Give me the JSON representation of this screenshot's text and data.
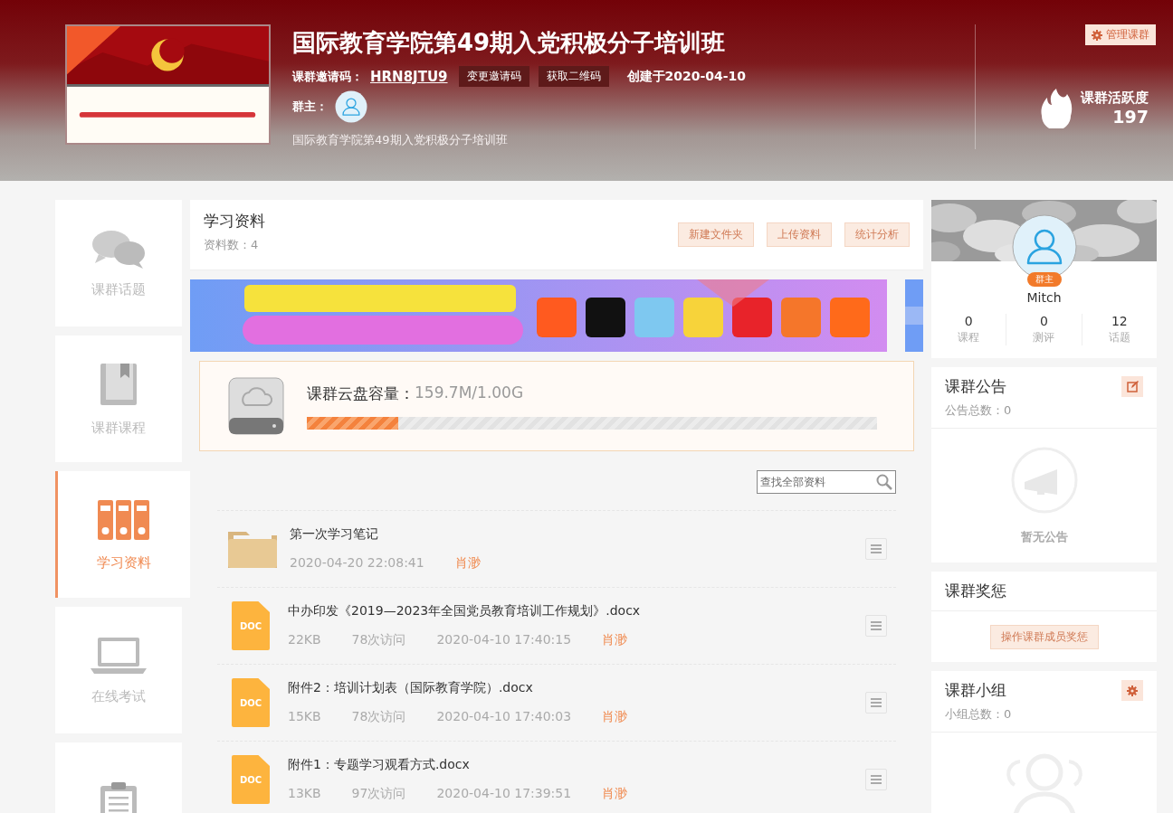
{
  "header": {
    "title": "国际教育学院第49期入党积极分子培训班",
    "invite_label": "课群邀请码：",
    "invite_code": "HRN8JTU9",
    "change_code_button": "变更邀请码",
    "qr_button": "获取二维码",
    "created": "创建于2020-04-10",
    "owner_label": "群主：",
    "description": "国际教育学院第49期入党积极分子培训班",
    "manage_button": "管理课群",
    "activity_label": "课群活跃度",
    "activity_value": "197"
  },
  "sidebar": {
    "items": [
      {
        "label": "课群话题",
        "selected": false
      },
      {
        "label": "课群课程",
        "selected": false
      },
      {
        "label": "学习资料",
        "selected": true
      },
      {
        "label": "在线考试",
        "selected": false
      },
      {
        "selected": false
      }
    ]
  },
  "materials": {
    "title": "学习资料",
    "count": "资料数：4",
    "buttons": [
      "新建文件夹",
      "上传资料",
      "统计分析"
    ],
    "storage": {
      "label": "课群云盘容量：",
      "value": "159.7M/1.00G",
      "level": 0.16
    },
    "search": {
      "placeholder": "查找全部资料"
    },
    "files": [
      {
        "kind": "folder",
        "name": "第一次学习笔记",
        "time": "2020-04-20 22:08:41",
        "author": "肖渺"
      },
      {
        "kind": "doc",
        "icon_text": "DOC",
        "name": "中办印发《2019—2023年全国党员教育培训工作规划》.docx",
        "size": "22KB",
        "visits": "78次访问",
        "time": "2020-04-10 17:40:15",
        "author": "肖渺"
      },
      {
        "kind": "doc",
        "icon_text": "DOC",
        "name": "附件2：培训计划表（国际教育学院）.docx",
        "size": "15KB",
        "visits": "78次访问",
        "time": "2020-04-10 17:40:03",
        "author": "肖渺"
      },
      {
        "kind": "doc",
        "icon_text": "DOC",
        "name": "附件1：专题学习观看方式.docx",
        "size": "13KB",
        "visits": "97次访问",
        "time": "2020-04-10 17:39:51",
        "author": "肖渺"
      }
    ]
  },
  "profile": {
    "badge": "群主",
    "name": "Mitch",
    "stats": [
      {
        "value": "0",
        "label": "课程"
      },
      {
        "value": "0",
        "label": "测评"
      },
      {
        "value": "12",
        "label": "话题"
      }
    ]
  },
  "announcements": {
    "title": "课群公告",
    "count": "公告总数：0",
    "empty": "暂无公告"
  },
  "rewards": {
    "title": "课群奖惩",
    "button": "操作课群成员奖惩"
  },
  "groups": {
    "title": "课群小组",
    "count": "小组总数：0"
  }
}
